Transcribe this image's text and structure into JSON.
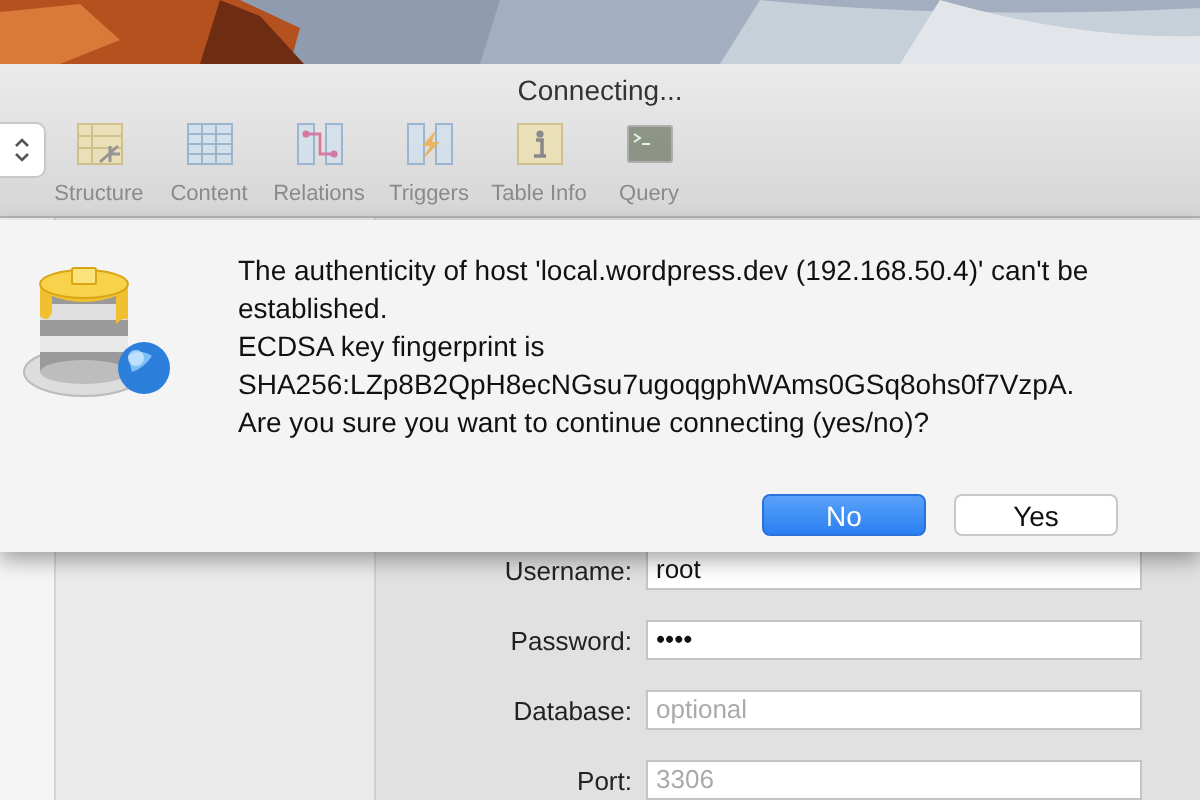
{
  "window": {
    "title": "Connecting..."
  },
  "toolbar": {
    "items": [
      {
        "label": "Structure",
        "kind": "structure",
        "disabled": true
      },
      {
        "label": "Content",
        "kind": "content",
        "disabled": true
      },
      {
        "label": "Relations",
        "kind": "relations",
        "disabled": true
      },
      {
        "label": "Triggers",
        "kind": "triggers",
        "disabled": true
      },
      {
        "label": "Table Info",
        "kind": "info",
        "disabled": true
      },
      {
        "label": "Query",
        "kind": "query",
        "disabled": true
      }
    ]
  },
  "dialog": {
    "lines": [
      "The authenticity of host 'local.wordpress.dev (192.168.50.4)' can't be established.",
      "ECDSA key fingerprint is",
      "SHA256:LZp8B2QpH8ecNGsu7ugoqgphWAms0GSq8ohs0f7VzpA.",
      "Are you sure you want to continue connecting (yes/no)?"
    ],
    "buttons": [
      {
        "label": "No",
        "default": true
      },
      {
        "label": "Yes",
        "default": false
      }
    ]
  },
  "form": {
    "fields": [
      {
        "label": "Username:",
        "value": "root"
      },
      {
        "label": "Password:",
        "value": "••••"
      },
      {
        "label": "Database:",
        "placeholder": "optional"
      },
      {
        "label": "Port:",
        "placeholder": "3306"
      }
    ]
  }
}
